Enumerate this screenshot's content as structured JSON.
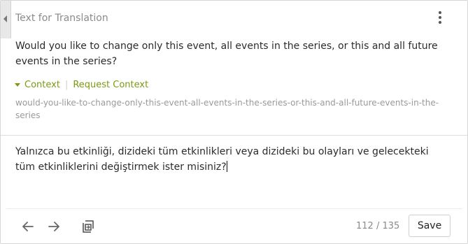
{
  "panel": {
    "title": "Text for Translation",
    "collapse_icon": "chevron-left-icon",
    "menu_icon": "more-vertical-icon"
  },
  "source": {
    "text": "Would you like to change only this event, all events in the series, or this and all future events in the series?"
  },
  "context": {
    "toggle_label": "Context",
    "separator": "|",
    "request_label": "Request Context",
    "key": "would-you-like-to-change-only-this-event-all-events-in-the-series-or-this-and-all-future-events-in-the-series"
  },
  "translation": {
    "text": "Yalnızca bu etkinliği, dizideki tüm etkinlikleri veya dizideki bu olayları ve gelecekteki tüm etkinliklerini değiştirmek ister misiniz?"
  },
  "footer": {
    "prev_icon": "arrow-left-icon",
    "next_icon": "arrow-right-icon",
    "copy_icon": "copy-source-icon",
    "char_count": "112 / 135",
    "save_label": "Save"
  },
  "colors": {
    "accent": "#7a9a12",
    "muted_text": "#8a8a8a",
    "border": "#d6d6d6"
  }
}
